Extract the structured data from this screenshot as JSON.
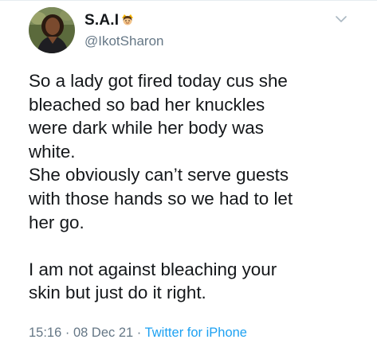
{
  "tweet": {
    "display_name": "S.A.I",
    "display_name_emoji": "queen-emoji",
    "handle": "@IkotSharon",
    "text_lines": [
      "So a lady got fired today cus she",
      "bleached so bad her knuckles",
      "were dark while her body was",
      "white.",
      "She obviously can’t serve guests",
      "with those hands so we had to let",
      "her go."
    ],
    "text_lines_2": [
      "I am not against bleaching your",
      "skin but just do it right."
    ],
    "time": "15:16",
    "separator": "·",
    "date": "08 Dec 21",
    "source": "Twitter for iPhone"
  },
  "colors": {
    "text": "#14171a",
    "secondary": "#657786",
    "link": "#1da1f2"
  },
  "icons": {
    "menu": "chevron-down-icon",
    "avatar": "profile-photo"
  }
}
